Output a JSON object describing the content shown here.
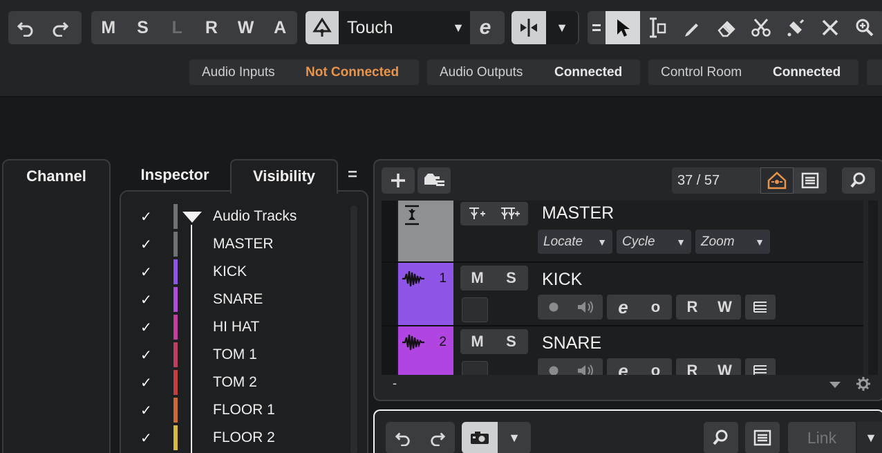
{
  "toolbar": {
    "undo": "undo-icon",
    "redo": "redo-icon",
    "automation_modes": [
      "M",
      "S",
      "L",
      "R",
      "W",
      "A"
    ],
    "automation_mode_value": "Touch",
    "editor_glyph": "e",
    "tools": [
      "object-selection-icon",
      "range-selection-icon",
      "draw-icon",
      "erase-icon",
      "split-icon",
      "glue-icon",
      "mute-tool-icon",
      "zoom-icon"
    ]
  },
  "connections": [
    {
      "label": "Audio Inputs",
      "status": "Not Connected",
      "status_color": "#e8944a"
    },
    {
      "label": "Audio Outputs",
      "status": "Connected",
      "status_color": "#e8e8e8"
    },
    {
      "label": "Control Room",
      "status": "Connected",
      "status_color": "#e8e8e8"
    }
  ],
  "left_zone": {
    "tab_channel": "Channel",
    "tab_inspector": "Inspector",
    "tab_visibility": "Visibility",
    "menu_glyph": "="
  },
  "visibility": {
    "items": [
      {
        "name": "Audio Tracks",
        "checked": "✓",
        "color": "#707174"
      },
      {
        "name": "MASTER",
        "checked": "✓",
        "color": "#707174"
      },
      {
        "name": "KICK",
        "checked": "✓",
        "color": "#8e55e6"
      },
      {
        "name": "SNARE",
        "checked": "✓",
        "color": "#b04ed8"
      },
      {
        "name": "HI HAT",
        "checked": "✓",
        "color": "#c2409a"
      },
      {
        "name": "TOM 1",
        "checked": "✓",
        "color": "#c03d62"
      },
      {
        "name": "TOM 2",
        "checked": "✓",
        "color": "#c43f3f"
      },
      {
        "name": "FLOOR 1",
        "checked": "✓",
        "color": "#cc6a3a"
      },
      {
        "name": "FLOOR 2",
        "checked": "✓",
        "color": "#d6b845"
      }
    ]
  },
  "project": {
    "track_count": "37 / 57",
    "scroll_glyph": "-",
    "tracks": [
      {
        "name": "MASTER",
        "color": "#8f9093",
        "locate": "Locate",
        "cycle": "Cycle",
        "zoom": "Zoom"
      },
      {
        "name": "KICK",
        "number": "1",
        "color": "#8e55e6",
        "mute": "M",
        "solo": "S",
        "read": "R",
        "write": "W",
        "editor": "e",
        "o": "o"
      },
      {
        "name": "SNARE",
        "number": "2",
        "color": "#b045e2",
        "mute": "M",
        "solo": "S",
        "read": "R",
        "write": "W",
        "editor": "e",
        "o": "o"
      }
    ]
  },
  "bottom": {
    "link_label": "Link"
  }
}
